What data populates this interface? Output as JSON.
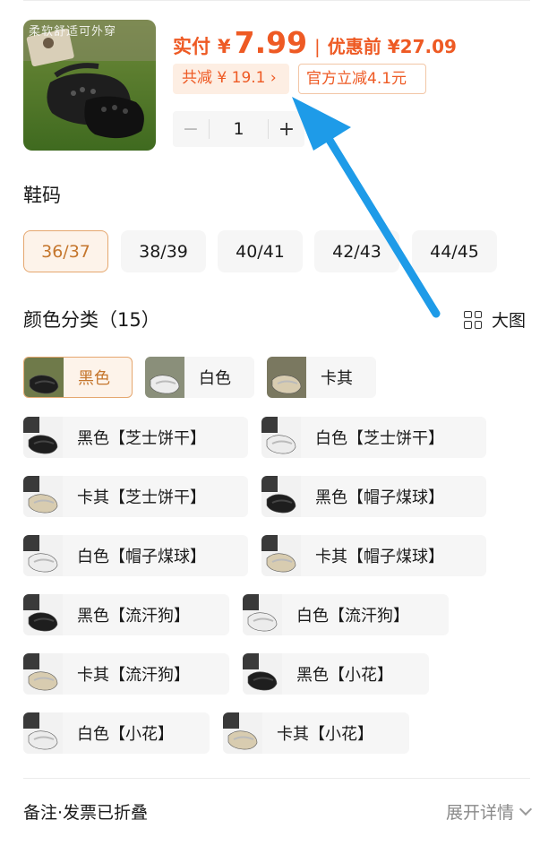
{
  "product": {
    "thumb_caption": "柔软舒适可外穿",
    "price_label": "实付",
    "currency": "¥",
    "price_value": "7.99",
    "separator": "|",
    "original_price": "优惠前 ¥27.09",
    "tag_total_discount": "共减 ¥ 19.1 ›",
    "tag_official": "官方立减4.1元",
    "quantity": "1",
    "minus_label": "−",
    "plus_label": "+"
  },
  "sizes": {
    "title": "鞋码",
    "options": [
      "36/37",
      "38/39",
      "40/41",
      "42/43",
      "44/45"
    ],
    "selected": "36/37"
  },
  "colors": {
    "title": "颜色分类（15）",
    "big_view_label": "大图",
    "options": [
      {
        "label": "黑色",
        "shoe": "black"
      },
      {
        "label": "白色",
        "shoe": "white"
      },
      {
        "label": "卡其",
        "shoe": "khaki"
      },
      {
        "label": "黑色【芝士饼干】",
        "shoe": "black"
      },
      {
        "label": "白色【芝士饼干】",
        "shoe": "white"
      },
      {
        "label": "卡其【芝士饼干】",
        "shoe": "khaki"
      },
      {
        "label": "黑色【帽子煤球】",
        "shoe": "black"
      },
      {
        "label": "白色【帽子煤球】",
        "shoe": "white"
      },
      {
        "label": "卡其【帽子煤球】",
        "shoe": "khaki"
      },
      {
        "label": "黑色【流汗狗】",
        "shoe": "black"
      },
      {
        "label": "白色【流汗狗】",
        "shoe": "white"
      },
      {
        "label": "卡其【流汗狗】",
        "shoe": "khaki"
      },
      {
        "label": "黑色【小花】",
        "shoe": "black"
      },
      {
        "label": "白色【小花】",
        "shoe": "white"
      },
      {
        "label": "卡其【小花】",
        "shoe": "khaki"
      }
    ],
    "selected": "黑色"
  },
  "footer": {
    "left_label": "备注·发票已折叠",
    "right_label": "展开详情"
  },
  "theme": {
    "accent": "#ee5a24",
    "selected_text": "#c5762d",
    "selected_border": "#e5a76f",
    "selected_bg": "#fdf3ea",
    "chip_bg": "#f6f6f6",
    "annotation_arrow": "#1e9be8"
  }
}
